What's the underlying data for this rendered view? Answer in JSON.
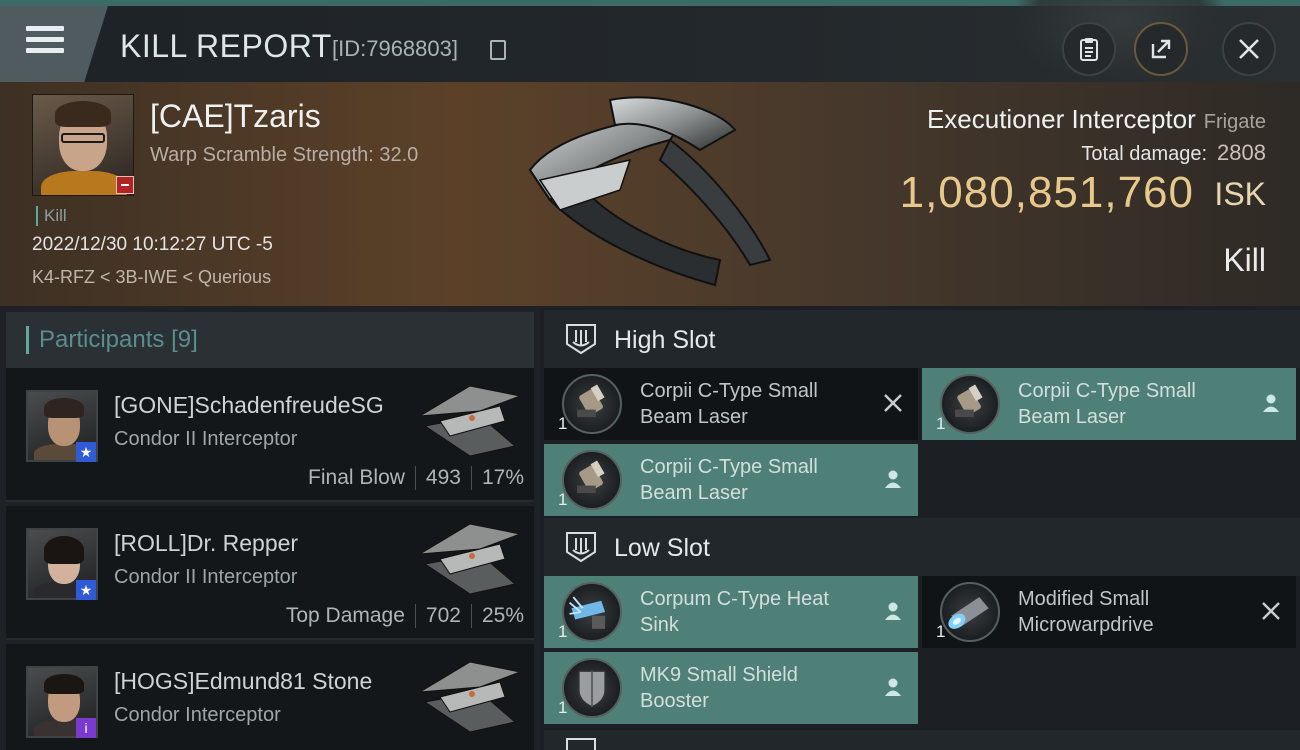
{
  "header": {
    "title": "KILL REPORT",
    "report_id": "[ID:7968803]",
    "buttons": [
      "clipboard-icon",
      "share-icon",
      "close-icon"
    ]
  },
  "victim": {
    "name": "[CAE]Tzaris",
    "warp_scramble": "Warp Scramble Strength: 32.0",
    "tag": "Kill",
    "datetime": "2022/12/30 10:12:27 UTC -5",
    "location": "K4-RFZ < 3B-IWE < Querious",
    "ship": "Executioner Interceptor",
    "ship_class": "Frigate",
    "total_damage_label": "Total damage:",
    "total_damage": "2808",
    "isk_value": "1,080,851,760",
    "isk_unit": "ISK",
    "result": "Kill"
  },
  "participants": {
    "label": "Participants",
    "count": "[9]",
    "items": [
      {
        "name": "[GONE]SchadenfreudeSG",
        "ship": "Condor II Interceptor",
        "role": "Final Blow",
        "damage": "493",
        "percent": "17%"
      },
      {
        "name": "[ROLL]Dr. Repper",
        "ship": "Condor II Interceptor",
        "role": "Top Damage",
        "damage": "702",
        "percent": "25%"
      },
      {
        "name": "[HOGS]Edmund81 Stone",
        "ship": "Condor Interceptor",
        "role": "",
        "damage": "",
        "percent": ""
      }
    ]
  },
  "slots": {
    "high": {
      "label": "High Slot",
      "modules": [
        {
          "name": "Corpii C-Type Small Beam Laser",
          "qty": "1",
          "state": "destroyed"
        },
        {
          "name": "Corpii C-Type Small Beam Laser",
          "qty": "1",
          "state": "dropped"
        },
        {
          "name": "Corpii C-Type Small Beam Laser",
          "qty": "1",
          "state": "dropped"
        }
      ]
    },
    "low": {
      "label": "Low Slot",
      "modules": [
        {
          "name": "Corpum C-Type Heat Sink",
          "qty": "1",
          "state": "dropped"
        },
        {
          "name": "Modified Small Microwarpdrive",
          "qty": "1",
          "state": "destroyed"
        },
        {
          "name": "MK9 Small Shield Booster",
          "qty": "1",
          "state": "dropped"
        }
      ]
    }
  },
  "colors": {
    "accent": "#5fa8a0",
    "isk": "#e8c98c",
    "dropped": "#4e8078",
    "destroyed": "#111416"
  }
}
